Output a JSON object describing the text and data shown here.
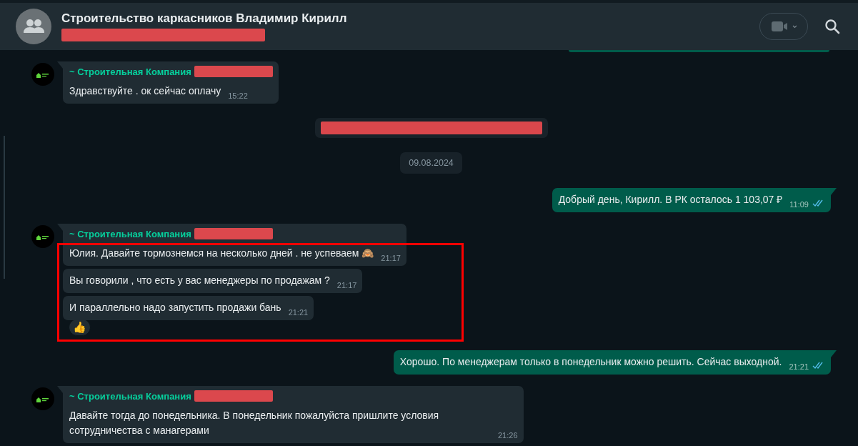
{
  "header": {
    "title": "Строительство каркасников Владимир Кирилл",
    "subtitle_redacted": true
  },
  "messages": [
    {
      "kind": "incoming",
      "sender": "~ Строительная Компания",
      "sender_phone_redacted": true,
      "highlighted": false,
      "bubbles": [
        {
          "text": "Здравствуйте . ок сейчас  оплачу",
          "time": "15:22"
        }
      ]
    },
    {
      "kind": "system",
      "redacted": true
    },
    {
      "kind": "date",
      "text": "09.08.2024"
    },
    {
      "kind": "outgoing",
      "text": "Добрый день, Кирилл. В РК осталось  1 103,07 ₽",
      "time": "11:09",
      "read": true
    },
    {
      "kind": "incoming",
      "sender": "~ Строительная Компания",
      "sender_phone_redacted": true,
      "highlighted": true,
      "bubbles": [
        {
          "text": "Юлия. Давайте тормознемся на несколько дней . не успеваем 🙈",
          "time": "21:17"
        },
        {
          "text": "Вы говорили , что есть у вас менеджеры по продажам ?",
          "time": "21:17"
        },
        {
          "text": "И параллельно надо запустить продажи бань",
          "time": "21:21",
          "reaction": "👍"
        }
      ]
    },
    {
      "kind": "outgoing",
      "text": "Хорошо. По менеджерам только в понедельник можно решить. Сейчас выходной.",
      "time": "21:21",
      "read": true
    },
    {
      "kind": "incoming",
      "sender": "~ Строительная Компания",
      "sender_phone_redacted": true,
      "highlighted": false,
      "bubbles": [
        {
          "text": "Давайте тогда до понедельника. В понедельник пожалуйста пришлите условия сотрудничества с манагерами",
          "time": "21:26"
        }
      ]
    }
  ]
}
